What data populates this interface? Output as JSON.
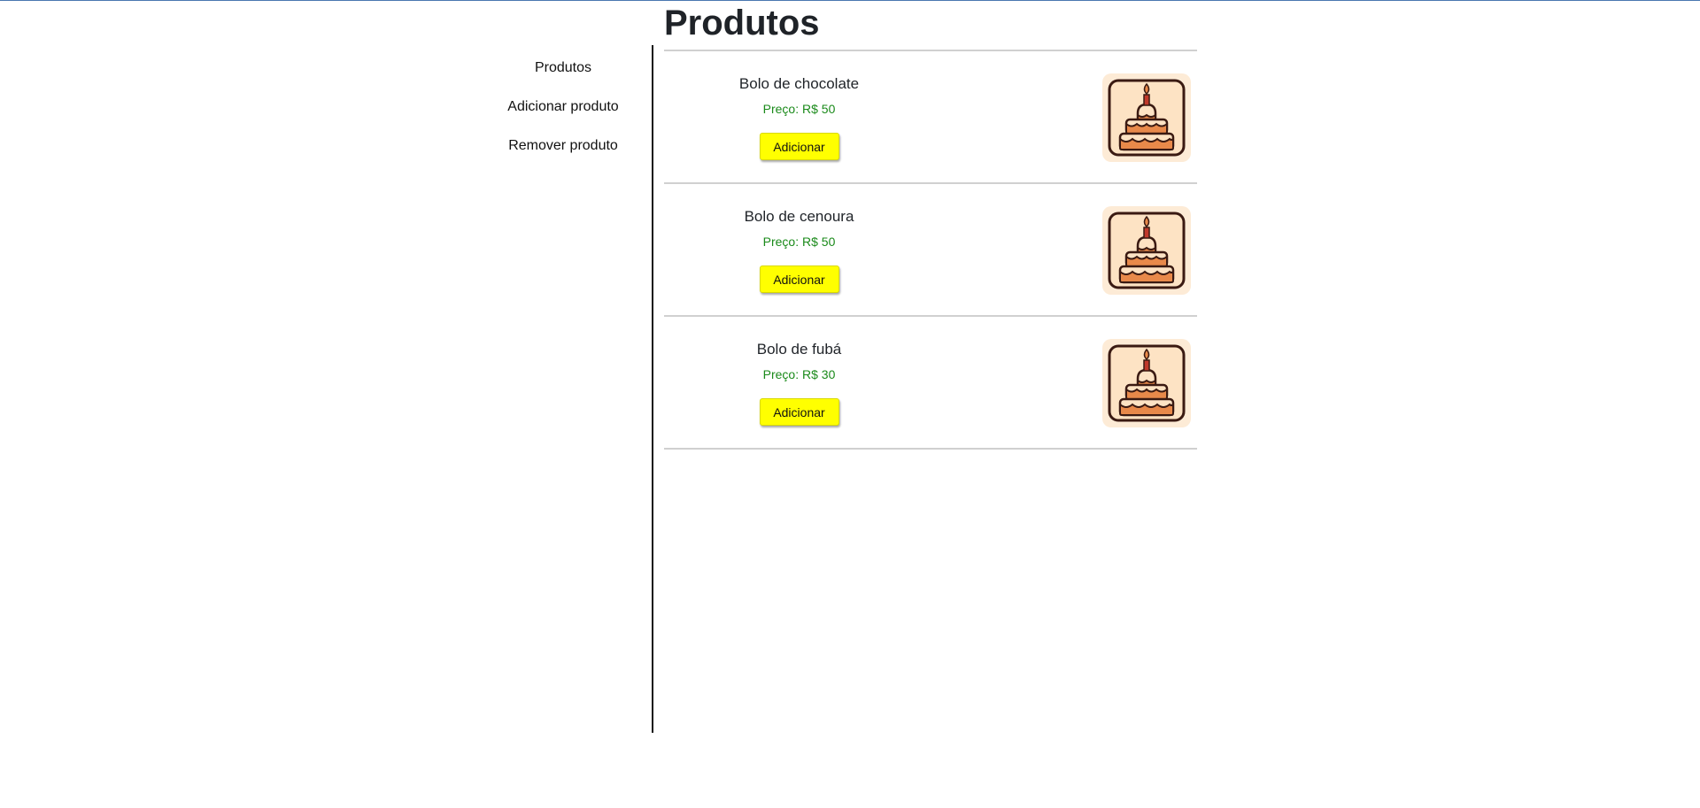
{
  "page": {
    "title": "Produtos"
  },
  "sidebar": {
    "items": [
      {
        "label": "Produtos"
      },
      {
        "label": "Adicionar produto"
      },
      {
        "label": "Remover produto"
      }
    ]
  },
  "products": [
    {
      "name": "Bolo de chocolate",
      "price": "Preço: R$ 50",
      "button_label": "Adicionar",
      "image_icon": "cake-icon"
    },
    {
      "name": "Bolo de cenoura",
      "price": "Preço: R$ 50",
      "button_label": "Adicionar",
      "image_icon": "cake-icon"
    },
    {
      "name": "Bolo de fubá",
      "price": "Preço: R$ 30",
      "button_label": "Adicionar",
      "image_icon": "cake-icon"
    }
  ],
  "colors": {
    "button_background": "#ffff00",
    "price_text": "#1a8a1a",
    "image_background": "#fdebd6",
    "cake_orange": "#e8894a",
    "cake_cream": "#fde3c4",
    "outline": "#3a1a12"
  }
}
